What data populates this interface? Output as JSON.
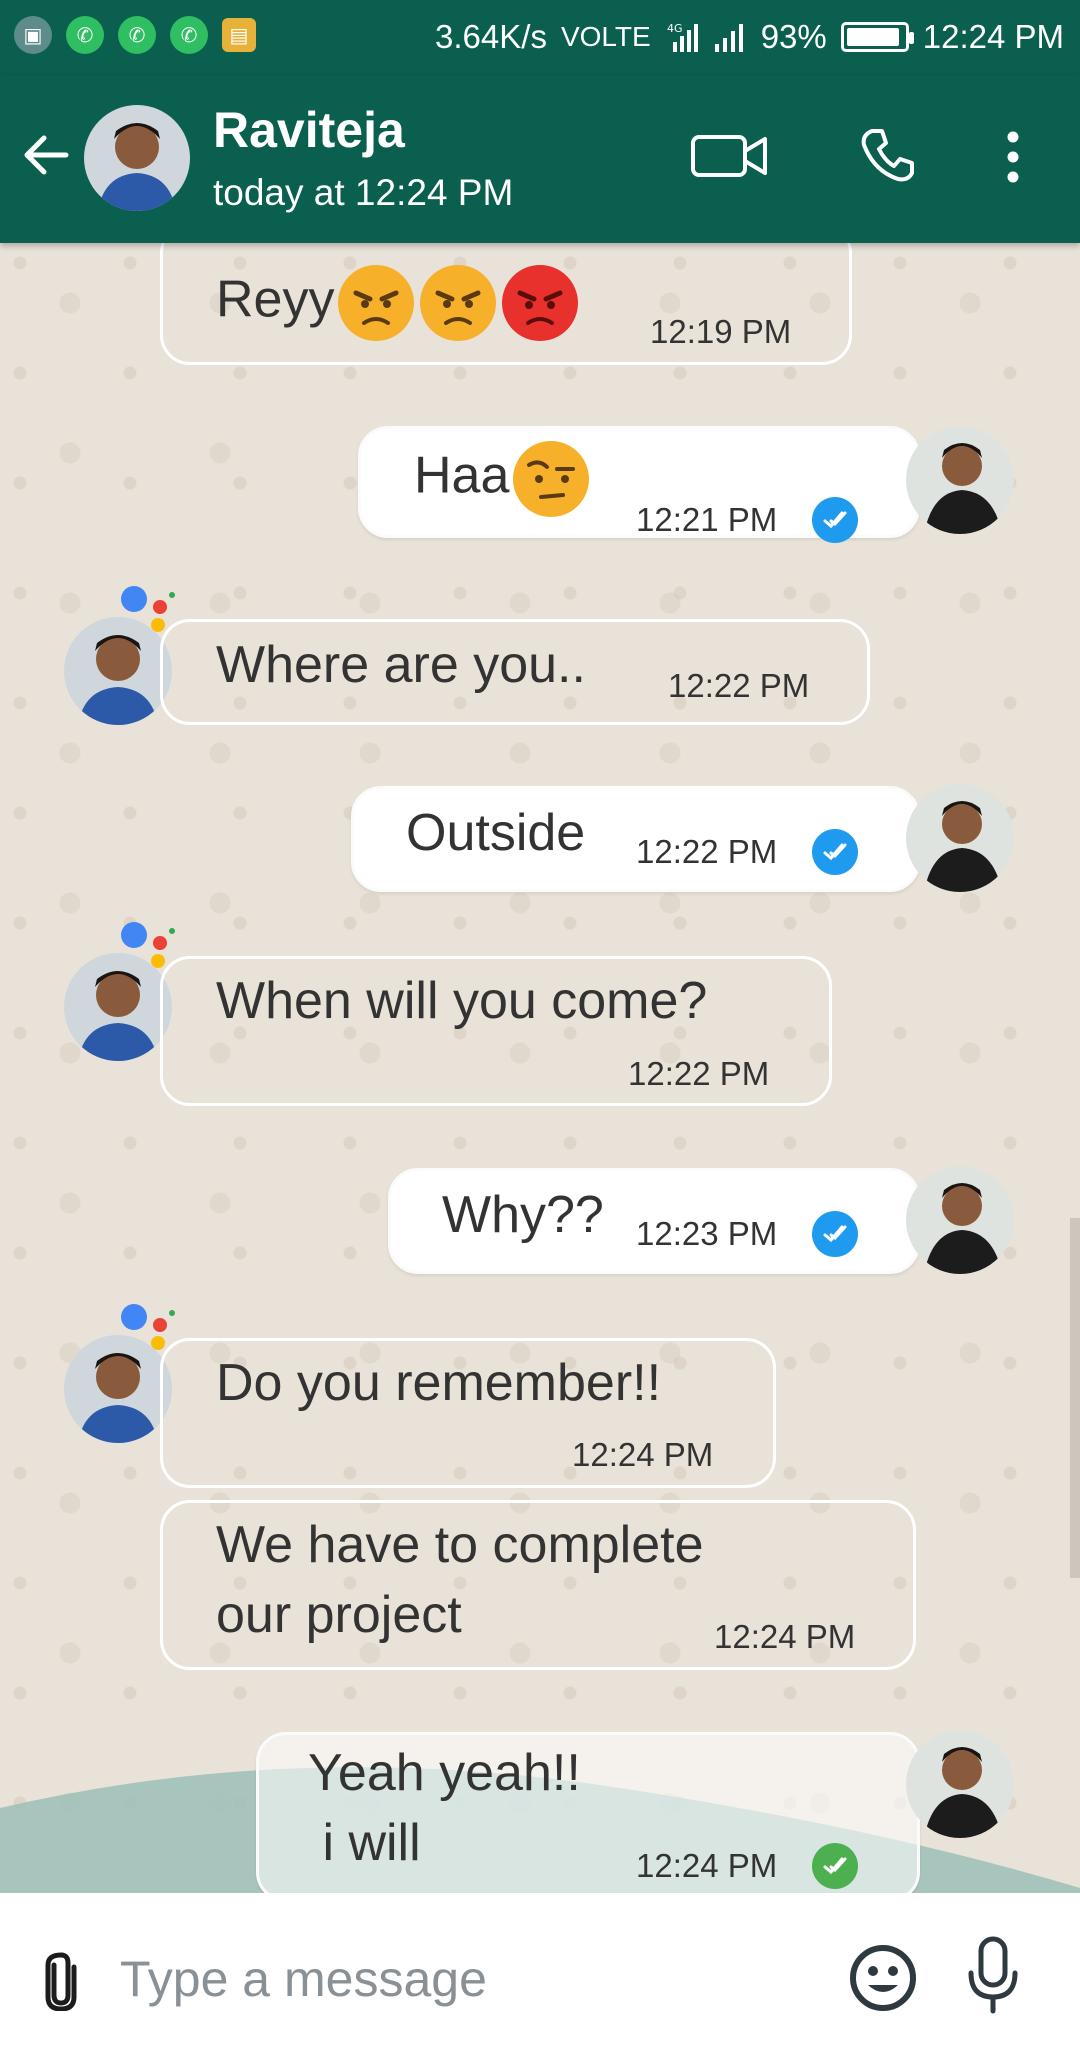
{
  "status_bar": {
    "speed": "3.64K/s",
    "network": "VOLTE",
    "lte": "4G",
    "battery": "93%",
    "battery_level": 0.93,
    "time": "12:24 PM"
  },
  "header": {
    "contact_name": "Raviteja",
    "last_seen": "today at 12:24 PM"
  },
  "messages": [
    {
      "direction": "in",
      "text": "Reyy",
      "emojis": [
        "angry-face",
        "angry-face",
        "pouting-face"
      ],
      "time": "12:19 PM"
    },
    {
      "direction": "out",
      "text": "Haa",
      "emojis": [
        "raised-eyebrow-face"
      ],
      "time": "12:21 PM",
      "status": "read"
    },
    {
      "direction": "in",
      "text": "Where are you..",
      "time": "12:22 PM"
    },
    {
      "direction": "out",
      "text": "Outside",
      "time": "12:22 PM",
      "status": "read"
    },
    {
      "direction": "in",
      "text": "When will you come?",
      "time": "12:22 PM"
    },
    {
      "direction": "out",
      "text": "Why??",
      "time": "12:23 PM",
      "status": "read"
    },
    {
      "direction": "in",
      "text": "Do you remember!!",
      "time": "12:24 PM"
    },
    {
      "direction": "in",
      "line1": "We have to complete",
      "line2": "our project",
      "time": "12:24 PM"
    },
    {
      "direction": "out",
      "line1": "Yeah yeah!!",
      "line2": " i will",
      "time": "12:24 PM",
      "status": "delivered"
    }
  ],
  "input": {
    "placeholder": "Type a message"
  },
  "colors": {
    "header": "#0a5f4f",
    "chat_background": "#e9e2d8",
    "read_tick": "#1e9bef",
    "delivered_tick": "#4caf50"
  }
}
